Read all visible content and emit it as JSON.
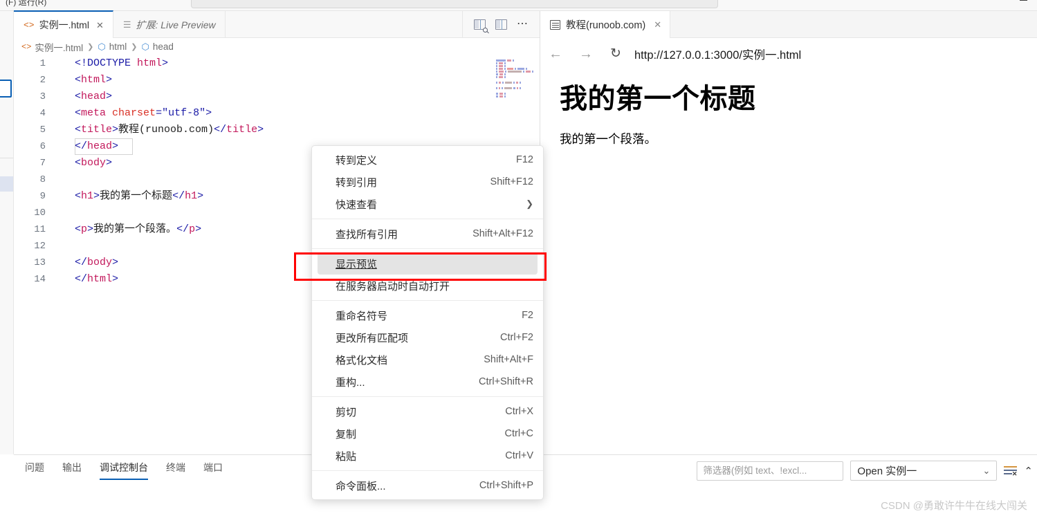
{
  "menubar": {
    "text": "(F) 运行(R)",
    "caret": "/"
  },
  "editor": {
    "tabs": [
      {
        "label": "实例一.html",
        "icon": "html-file-icon",
        "active": true,
        "closable": true,
        "close_label": "✕"
      },
      {
        "label": "扩展: Live Preview",
        "icon": "extension-icon",
        "active": false,
        "closable": false
      }
    ],
    "actions": [
      {
        "name": "open-preview-to-the-side-icon"
      },
      {
        "name": "split-editor-icon"
      },
      {
        "name": "more-actions-icon",
        "label": "⋯"
      }
    ],
    "breadcrumb": [
      {
        "label": "实例一.html",
        "icon": "html-file-icon"
      },
      {
        "label": "html",
        "icon": "cube-icon"
      },
      {
        "label": "head",
        "icon": "cube-icon"
      }
    ],
    "breadcrumb_separator": "❯",
    "lines": [
      {
        "n": "1",
        "tokens": [
          {
            "t": "punc",
            "v": "<!DOCTYPE "
          },
          {
            "t": "tag",
            "v": "html"
          },
          {
            "t": "punc",
            "v": ">"
          }
        ]
      },
      {
        "n": "2",
        "tokens": [
          {
            "t": "punc",
            "v": "<"
          },
          {
            "t": "tag",
            "v": "html"
          },
          {
            "t": "punc",
            "v": ">"
          }
        ]
      },
      {
        "n": "3",
        "tokens": [
          {
            "t": "punc",
            "v": "<"
          },
          {
            "t": "tag",
            "v": "head"
          },
          {
            "t": "punc",
            "v": ">"
          }
        ]
      },
      {
        "n": "4",
        "tokens": [
          {
            "t": "punc",
            "v": "<"
          },
          {
            "t": "tag",
            "v": "meta"
          },
          {
            "t": "punc",
            "v": " "
          },
          {
            "t": "attr",
            "v": "charset"
          },
          {
            "t": "punc",
            "v": "="
          },
          {
            "t": "val",
            "v": "\"utf-8\""
          },
          {
            "t": "punc",
            "v": ">"
          }
        ]
      },
      {
        "n": "5",
        "tokens": [
          {
            "t": "punc",
            "v": "<"
          },
          {
            "t": "tag",
            "v": "title"
          },
          {
            "t": "punc",
            "v": ">"
          },
          {
            "t": "text",
            "v": "教程(runoob.com)"
          },
          {
            "t": "punc",
            "v": "</"
          },
          {
            "t": "tag",
            "v": "title"
          },
          {
            "t": "punc",
            "v": ">"
          }
        ]
      },
      {
        "n": "6",
        "tokens": [
          {
            "t": "punc",
            "v": "</"
          },
          {
            "t": "tag",
            "v": "head"
          },
          {
            "t": "punc",
            "v": ">"
          }
        ]
      },
      {
        "n": "7",
        "tokens": [
          {
            "t": "punc",
            "v": "<"
          },
          {
            "t": "tag",
            "v": "body"
          },
          {
            "t": "punc",
            "v": ">"
          }
        ]
      },
      {
        "n": "8",
        "tokens": []
      },
      {
        "n": "9",
        "tokens": [
          {
            "t": "punc",
            "v": "<"
          },
          {
            "t": "tag",
            "v": "h1"
          },
          {
            "t": "punc",
            "v": ">"
          },
          {
            "t": "text",
            "v": "我的第一个标题"
          },
          {
            "t": "punc",
            "v": "</"
          },
          {
            "t": "tag",
            "v": "h1"
          },
          {
            "t": "punc",
            "v": ">"
          }
        ]
      },
      {
        "n": "10",
        "tokens": []
      },
      {
        "n": "11",
        "tokens": [
          {
            "t": "punc",
            "v": "<"
          },
          {
            "t": "tag",
            "v": "p"
          },
          {
            "t": "punc",
            "v": ">"
          },
          {
            "t": "text",
            "v": "我的第一个段落。"
          },
          {
            "t": "punc",
            "v": "</"
          },
          {
            "t": "tag",
            "v": "p"
          },
          {
            "t": "punc",
            "v": ">"
          }
        ]
      },
      {
        "n": "12",
        "tokens": []
      },
      {
        "n": "13",
        "tokens": [
          {
            "t": "punc",
            "v": "</"
          },
          {
            "t": "tag",
            "v": "body"
          },
          {
            "t": "punc",
            "v": ">"
          }
        ]
      },
      {
        "n": "14",
        "tokens": [
          {
            "t": "punc",
            "v": "</"
          },
          {
            "t": "tag",
            "v": "html"
          },
          {
            "t": "punc",
            "v": ">"
          }
        ]
      }
    ]
  },
  "context_menu": {
    "groups": [
      [
        {
          "label": "转到定义",
          "shortcut": "F12"
        },
        {
          "label": "转到引用",
          "shortcut": "Shift+F12"
        },
        {
          "label": "快速查看",
          "shortcut": "",
          "submenu": true,
          "arrow": "❯"
        }
      ],
      [
        {
          "label": "查找所有引用",
          "shortcut": "Shift+Alt+F12"
        }
      ],
      [
        {
          "label": "显示预览",
          "shortcut": "",
          "highlighted": true
        },
        {
          "label": "在服务器启动时自动打开",
          "shortcut": ""
        }
      ],
      [
        {
          "label": "重命名符号",
          "shortcut": "F2"
        },
        {
          "label": "更改所有匹配项",
          "shortcut": "Ctrl+F2"
        },
        {
          "label": "格式化文档",
          "shortcut": "Shift+Alt+F"
        },
        {
          "label": "重构...",
          "shortcut": "Ctrl+Shift+R"
        }
      ],
      [
        {
          "label": "剪切",
          "shortcut": "Ctrl+X"
        },
        {
          "label": "复制",
          "shortcut": "Ctrl+C"
        },
        {
          "label": "粘贴",
          "shortcut": "Ctrl+V"
        }
      ],
      [
        {
          "label": "命令面板...",
          "shortcut": "Ctrl+Shift+P"
        }
      ]
    ],
    "highlight_color": "#ff0000"
  },
  "panel": {
    "tabs": [
      {
        "label": "问题",
        "active": false
      },
      {
        "label": "输出",
        "active": false
      },
      {
        "label": "调试控制台",
        "active": true
      },
      {
        "label": "终端",
        "active": false
      },
      {
        "label": "端口",
        "active": false
      }
    ],
    "filter": {
      "value": "",
      "placeholder": "筛选器(例如 text、!excl..."
    },
    "context_select": {
      "value": "Open 实例一",
      "chevron": "⌄"
    },
    "clear_button": {
      "name": "clear-console-icon",
      "x": "✕"
    },
    "collapse_button": {
      "name": "chevron-up-icon",
      "glyph": "⌃"
    },
    "accent_color": "#0a5fb4"
  },
  "browser": {
    "tab": {
      "label": "教程(runoob.com)",
      "close": "✕"
    },
    "toolbar": {
      "back": "←",
      "forward": "→",
      "reload": "↻",
      "url": "http://127.0.0.1:3000/实例一.html"
    },
    "page": {
      "heading": "我的第一个标题",
      "paragraph": "我的第一个段落。"
    }
  },
  "watermark": "CSDN @勇敢许牛牛在线大闯关"
}
